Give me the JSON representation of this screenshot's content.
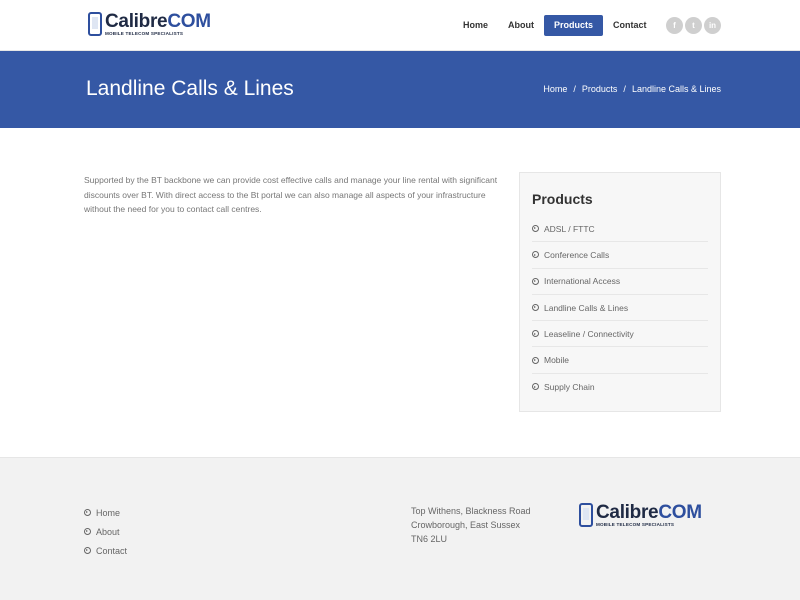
{
  "brand": {
    "name_main": "Calibre",
    "name_suffix": "COM",
    "tagline": "MOBILE TELECOM SPECIALISTS",
    "accent": "#3558a5"
  },
  "nav": {
    "items": [
      {
        "label": "Home"
      },
      {
        "label": "About"
      },
      {
        "label": "Products",
        "active": true
      },
      {
        "label": "Contact"
      }
    ]
  },
  "social": [
    {
      "icon": "facebook-icon",
      "glyph": "f"
    },
    {
      "icon": "twitter-icon",
      "glyph": "t"
    },
    {
      "icon": "linkedin-icon",
      "glyph": "in"
    }
  ],
  "banner": {
    "title": "Landline Calls & Lines",
    "breadcrumb": [
      "Home",
      "Products",
      "Landline Calls & Lines"
    ],
    "separator": "/"
  },
  "content": {
    "body": "Supported by the BT backbone we can provide cost effective calls and manage your line rental with significant discounts over BT. With direct access to the Bt portal we can also manage all aspects of your infrastructure without the need for you to contact call centres."
  },
  "sidebar": {
    "title": "Products",
    "items": [
      "ADSL / FTTC",
      "Conference Calls",
      "International Access",
      "Landline Calls & Lines",
      "Leaseline / Connectivity",
      "Mobile",
      "Supply Chain"
    ]
  },
  "footer": {
    "links": [
      "Home",
      "About",
      "Contact"
    ],
    "address": [
      "Top Withens, Blackness Road",
      "Crowborough, East Sussex",
      "TN6 2LU"
    ]
  }
}
